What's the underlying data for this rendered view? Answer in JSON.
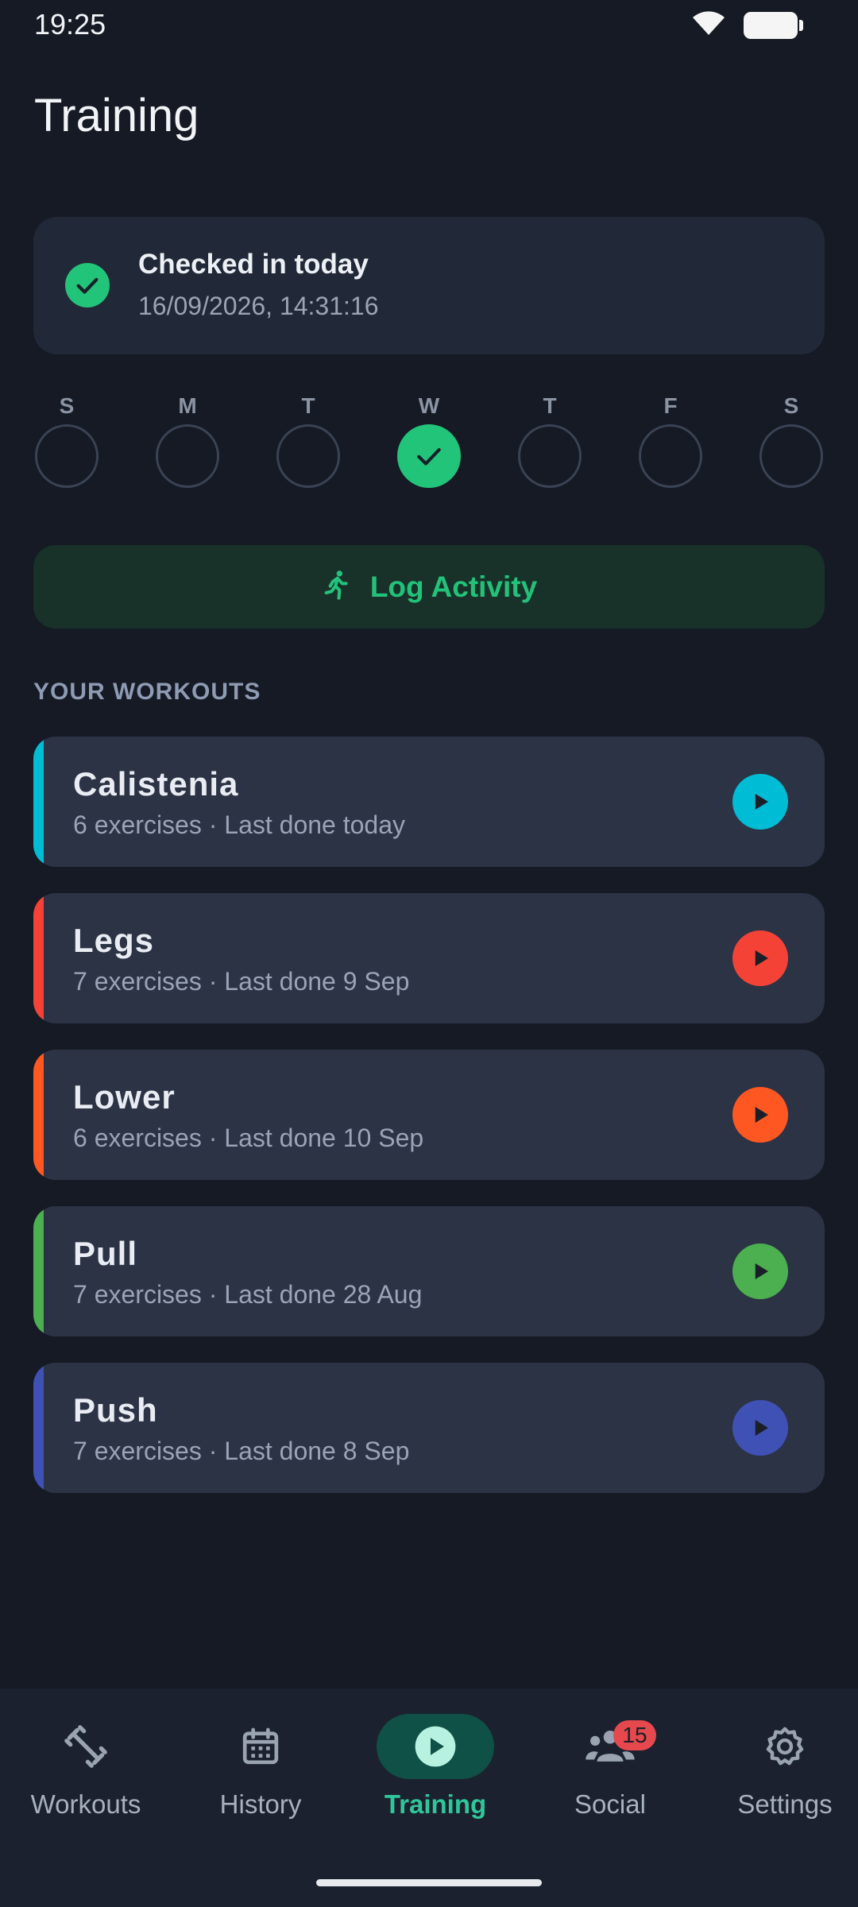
{
  "status_bar": {
    "time": "19:25",
    "icons": [
      "wifi-icon",
      "battery-icon"
    ]
  },
  "page": {
    "title": "Training"
  },
  "checkin": {
    "title": "Checked in today",
    "timestamp": "16/09/2026, 14:31:16",
    "icon": "check-circle-icon",
    "color": "#22c47a"
  },
  "week": {
    "days": [
      {
        "letter": "S",
        "checked": false
      },
      {
        "letter": "M",
        "checked": false
      },
      {
        "letter": "T",
        "checked": false
      },
      {
        "letter": "W",
        "checked": true
      },
      {
        "letter": "T",
        "checked": false
      },
      {
        "letter": "F",
        "checked": false
      },
      {
        "letter": "S",
        "checked": false
      }
    ]
  },
  "log_activity": {
    "label": "Log Activity",
    "icon": "running-person-icon",
    "color": "#23c27b"
  },
  "workouts_section": {
    "heading": "YOUR WORKOUTS",
    "items": [
      {
        "name": "Calistenia",
        "meta": "6 exercises · Last done today",
        "color": "#00bcd4"
      },
      {
        "name": "Legs",
        "meta": "7 exercises · Last done 9 Sep",
        "color": "#f44336"
      },
      {
        "name": "Lower",
        "meta": "6 exercises · Last done 10 Sep",
        "color": "#ff5722"
      },
      {
        "name": "Pull",
        "meta": "7 exercises · Last done 28 Aug",
        "color": "#4caf50"
      },
      {
        "name": "Push",
        "meta": "7 exercises · Last done 8 Sep",
        "color": "#3f51b5"
      }
    ]
  },
  "nav": {
    "items": [
      {
        "label": "Workouts",
        "icon": "dumbbell-icon",
        "active": false
      },
      {
        "label": "History",
        "icon": "calendar-icon",
        "active": false
      },
      {
        "label": "Training",
        "icon": "play-circle-icon",
        "active": true
      },
      {
        "label": "Social",
        "icon": "group-icon",
        "active": false,
        "badge": "15"
      },
      {
        "label": "Settings",
        "icon": "gear-icon",
        "active": false
      }
    ]
  }
}
